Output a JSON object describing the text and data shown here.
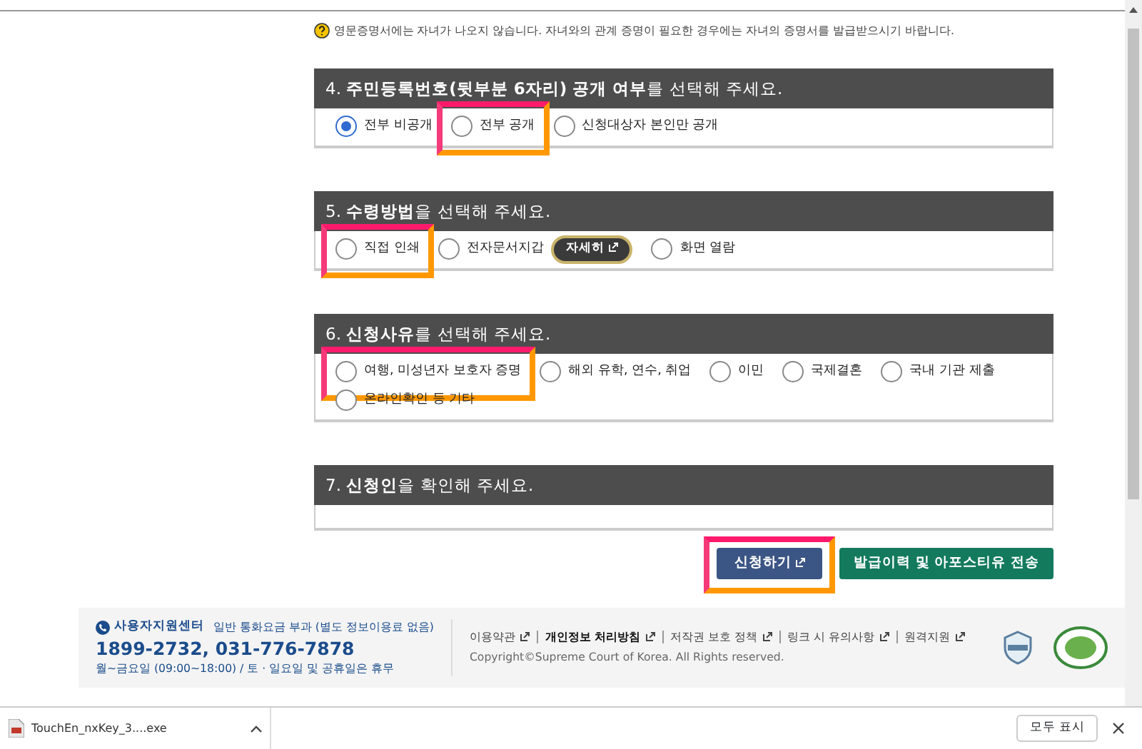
{
  "note": "영문증명서에는 자녀가 나오지 않습니다. 자녀와의 관계 증명이 필요한 경우에는 자녀의 증명서를 발급받으시기 바랍니다.",
  "sections": [
    {
      "heading": "4. **주민등록번호(뒷부분 6자리) 공개 여부**를 선택해 주세요.",
      "options": [
        {
          "label": "전부 비공개",
          "selected": true,
          "highlighted": false
        },
        {
          "label": "전부 공개",
          "selected": false,
          "highlighted": true
        },
        {
          "label": "신청대상자 본인만 공개",
          "selected": false,
          "highlighted": false
        }
      ]
    },
    {
      "heading": "5. **수령방법**을 선택해 주세요.",
      "options": [
        {
          "label": "직접 인쇄",
          "selected": false,
          "highlighted": true
        },
        {
          "label": "전자문서지갑",
          "selected": false,
          "highlighted": false,
          "detail_button": "자세히"
        },
        {
          "label": "화면 열람",
          "selected": false,
          "highlighted": false
        }
      ]
    },
    {
      "heading": "6. **신청사유**를 선택해 주세요.",
      "options": [
        {
          "label": "여행, 미성년자 보호자 증명",
          "selected": false,
          "highlighted": true
        },
        {
          "label": "해외 유학, 연수, 취업",
          "selected": false,
          "highlighted": false
        },
        {
          "label": "이민",
          "selected": false,
          "highlighted": false
        },
        {
          "label": "국제결혼",
          "selected": false,
          "highlighted": false
        },
        {
          "label": "국내 기관 제출",
          "selected": false,
          "highlighted": false
        },
        {
          "label": "온라인확인 등 기타",
          "selected": false,
          "highlighted": false
        }
      ]
    },
    {
      "heading": "7. **신청인**을 확인해 주세요."
    }
  ],
  "buttons": [
    {
      "label": "신청하기",
      "kind": "primary",
      "highlighted": true
    },
    {
      "label": "발급이력 및 아포스티유 전송",
      "kind": "success"
    }
  ],
  "footer": {
    "center_title": "사용자지원센터",
    "center_note": "일반 통화요금 부과 (별도 정보이용료 없음)",
    "phone": "1899-2732, 031-776-7878",
    "hours": "월~금요일 (09:00~18:00) / 토 · 일요일 및 공휴일은 휴무",
    "links": [
      {
        "label": "이용약관",
        "bold": false
      },
      {
        "label": "개인정보 처리방침",
        "bold": true
      },
      {
        "label": "저작권 보호 정책",
        "bold": false
      },
      {
        "label": "링크 시 유의사항",
        "bold": false
      },
      {
        "label": "원격지원",
        "bold": false
      }
    ],
    "copyright": "Copyright©Supreme Court of Korea. All Rights reserved."
  },
  "download_bar": {
    "file": "TouchEn_nxKey_3....exe",
    "show_all": "모두 표시"
  }
}
